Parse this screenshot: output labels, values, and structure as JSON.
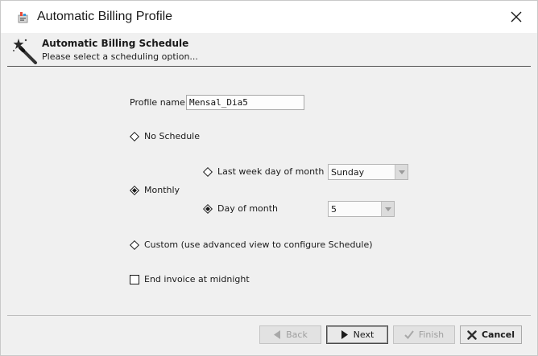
{
  "window": {
    "title": "Automatic Billing Profile",
    "close_glyph": "✕"
  },
  "banner": {
    "title": "Automatic Billing Schedule",
    "subtitle": "Please select a scheduling option..."
  },
  "form": {
    "profile_name_label": "Profile name:",
    "profile_name_value": "Mensal_Dia5",
    "options": {
      "no_schedule": {
        "label": "No Schedule",
        "selected": false
      },
      "monthly": {
        "label": "Monthly",
        "selected": true
      },
      "custom": {
        "label": "Custom (use advanced view to configure Schedule)",
        "selected": false
      }
    },
    "monthly_sub": {
      "last_week_day": {
        "label": "Last week day of month",
        "selected": false,
        "select_value": "Sunday"
      },
      "day_of_month": {
        "label": "Day of month",
        "selected": true,
        "select_value": "5"
      }
    },
    "end_invoice": {
      "label": "End invoice at midnight",
      "checked": false
    }
  },
  "footer": {
    "back_label": "Back",
    "next_label": "Next",
    "finish_label": "Finish",
    "cancel_label": "Cancel"
  },
  "colors": {
    "accent_red": "#c0392b",
    "disabled_text": "#9e9e9e"
  }
}
